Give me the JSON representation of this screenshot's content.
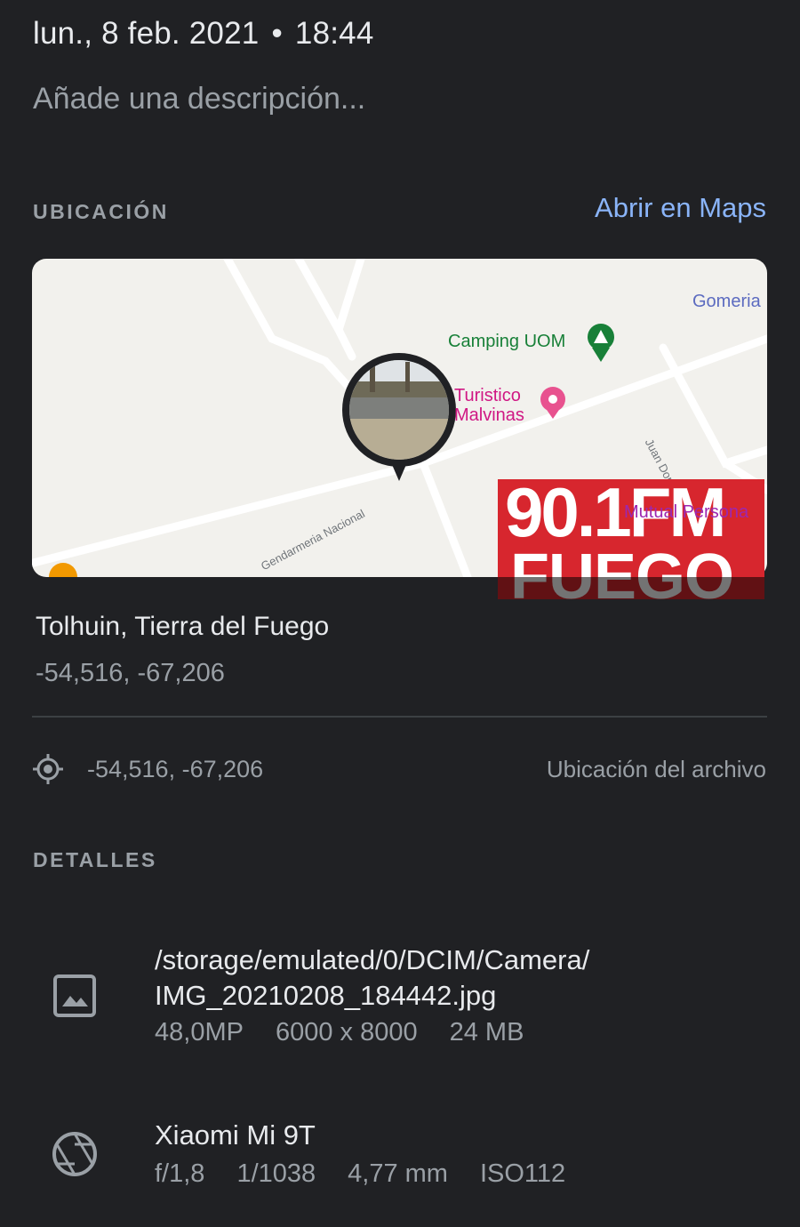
{
  "header": {
    "date": "lun., 8 feb. 2021",
    "separator": "•",
    "time": "18:44",
    "description_placeholder": "Añade una descripción..."
  },
  "location": {
    "section_label": "UBICACIÓN",
    "open_maps_label": "Abrir en Maps",
    "map": {
      "poi_camping": "Camping UOM",
      "poi_turistico_line1": "Turistico",
      "poi_turistico_line2": "Malvinas",
      "poi_gomeria": "Gomeria",
      "road_juan_domingo": "Juan Domingo Peron",
      "road_gendarmeria": "Gendarmeria Nacional",
      "overlay_poi": "Mutual Persona"
    },
    "watermark": {
      "line1": "90.1FM",
      "line2": "FUEGO"
    },
    "place_name": "Tolhuin, Tierra del Fuego",
    "place_coords": "-54,516, -67,206",
    "file_location_coords": "-54,516, -67,206",
    "file_location_label": "Ubicación del archivo"
  },
  "details": {
    "section_label": "DETALLES",
    "file": {
      "path_line1": "/storage/emulated/0/DCIM/Camera/",
      "path_line2": "IMG_20210208_184442.jpg",
      "megapixels": "48,0MP",
      "resolution": "6000 x 8000",
      "size": "24 MB"
    },
    "camera": {
      "model": "Xiaomi Mi 9T",
      "aperture": "f/1,8",
      "exposure": "1/1038",
      "focal_length": "4,77 mm",
      "iso": "ISO112"
    }
  },
  "colors": {
    "background": "#202124",
    "accent_link": "#8ab4f8",
    "camping_green": "#188038",
    "poi_pink": "#d01884",
    "watermark_red": "#d7262e"
  }
}
